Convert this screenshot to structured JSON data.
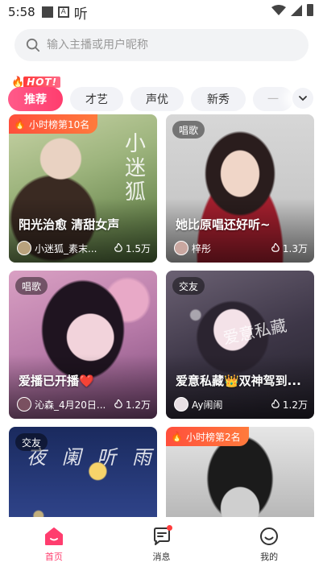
{
  "status": {
    "time": "5:58",
    "glyph": "听"
  },
  "search": {
    "placeholder": "输入主播或用户昵称"
  },
  "hot": {
    "label": "HOT!"
  },
  "tabs": [
    {
      "label": "推荐",
      "active": true
    },
    {
      "label": "才艺",
      "active": false
    },
    {
      "label": "声优",
      "active": false
    },
    {
      "label": "新秀",
      "active": false
    },
    {
      "label": "一",
      "active": false
    }
  ],
  "cards": [
    {
      "rank": "小时榜第10名",
      "tag": "",
      "title": "阳光治愈 清甜女声",
      "name": "小迷狐_素末...",
      "heat": "1.5万",
      "deco": "小迷狐"
    },
    {
      "rank": "",
      "tag": "唱歌",
      "title": "她比原唱还好听~",
      "name": "梓彤",
      "heat": "1.3万",
      "deco": ""
    },
    {
      "rank": "",
      "tag": "唱歌",
      "title": "爱播已开播❤️",
      "name": "沁森_4月20日...",
      "heat": "1.2万",
      "deco": ""
    },
    {
      "rank": "",
      "tag": "交友",
      "title": "爱意私藏👑双神驾到...",
      "name": "Ay闹闹",
      "heat": "1.2万",
      "deco": "爱意私藏"
    },
    {
      "rank": "",
      "tag": "交友",
      "title": "",
      "name": "",
      "heat": "",
      "deco": "夜 阑 听 雨"
    },
    {
      "rank": "小时榜第2名",
      "tag": "",
      "title": "",
      "name": "",
      "heat": "",
      "deco": ""
    }
  ],
  "nav": [
    {
      "label": "首页",
      "active": true,
      "icon": "home-icon"
    },
    {
      "label": "消息",
      "active": false,
      "icon": "message-icon"
    },
    {
      "label": "我的",
      "active": false,
      "icon": "profile-icon"
    }
  ],
  "colors": {
    "accent": "#ff3d6e",
    "rank": "#ff5a3c"
  }
}
